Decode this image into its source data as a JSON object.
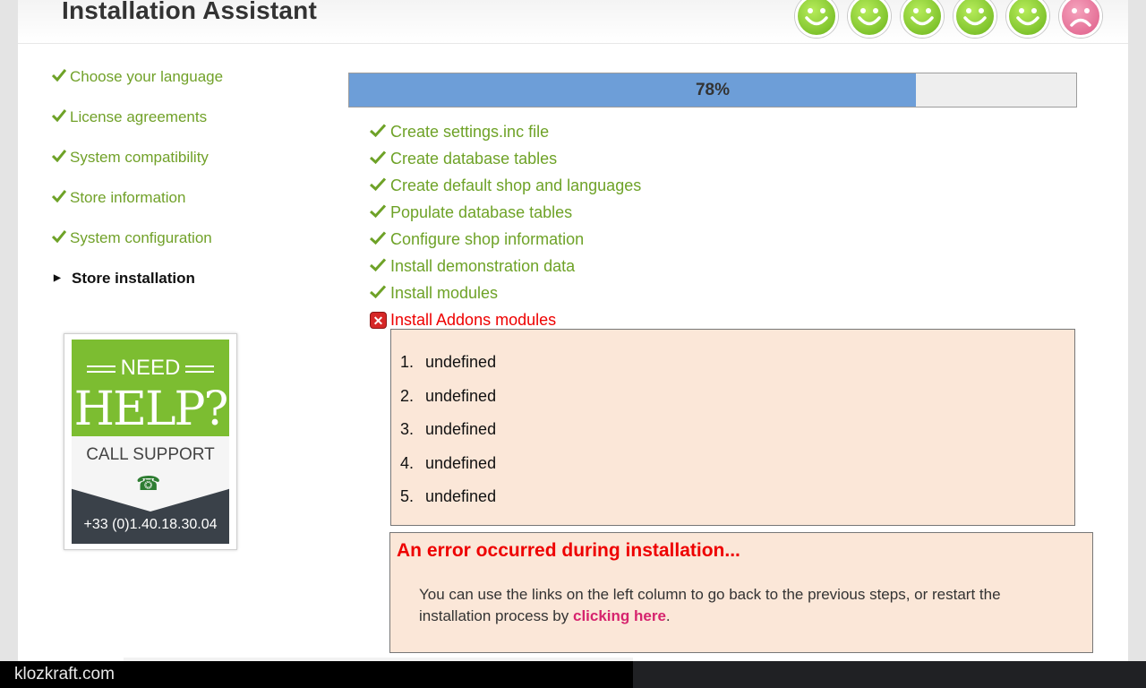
{
  "header": {
    "title": "Installation Assistant"
  },
  "smileys": [
    {
      "mood": "happy",
      "icon": "smiley-happy-icon",
      "color": "#79c22a"
    },
    {
      "mood": "happy",
      "icon": "smiley-happy-icon",
      "color": "#79c22a"
    },
    {
      "mood": "happy",
      "icon": "smiley-happy-icon",
      "color": "#79c22a"
    },
    {
      "mood": "happy",
      "icon": "smiley-happy-icon",
      "color": "#79c22a"
    },
    {
      "mood": "happy",
      "icon": "smiley-happy-icon",
      "color": "#79c22a"
    },
    {
      "mood": "sad",
      "icon": "smiley-sad-icon",
      "color": "#e06690"
    }
  ],
  "sidebar": {
    "items": [
      {
        "label": "Choose your language",
        "state": "done"
      },
      {
        "label": "License agreements",
        "state": "done"
      },
      {
        "label": "System compatibility",
        "state": "done"
      },
      {
        "label": "Store information",
        "state": "done"
      },
      {
        "label": "System configuration",
        "state": "done"
      },
      {
        "label": "Store installation",
        "state": "current"
      }
    ]
  },
  "help_banner": {
    "need": "NEED",
    "help": "HELP?",
    "call": "CALL SUPPORT",
    "phone": "+33 (0)1.40.18.30.04"
  },
  "progress": {
    "value": 0.78,
    "label": "78%"
  },
  "steps": [
    {
      "label": "Create settings.inc file",
      "status": "done"
    },
    {
      "label": "Create database tables",
      "status": "done"
    },
    {
      "label": "Create default shop and languages",
      "status": "done"
    },
    {
      "label": "Populate database tables",
      "status": "done"
    },
    {
      "label": "Configure shop information",
      "status": "done"
    },
    {
      "label": "Install demonstration data",
      "status": "done"
    },
    {
      "label": "Install modules",
      "status": "done"
    },
    {
      "label": "Install Addons modules",
      "status": "error"
    }
  ],
  "errors_list": [
    {
      "num": "1.",
      "text": "undefined"
    },
    {
      "num": "2.",
      "text": "undefined"
    },
    {
      "num": "3.",
      "text": "undefined"
    },
    {
      "num": "4.",
      "text": "undefined"
    },
    {
      "num": "5.",
      "text": "undefined"
    }
  ],
  "error_box": {
    "title": "An error occurred during installation...",
    "text_before": "You can use the links on the left column to go back to the previous steps, or restart the installation process by ",
    "link": "clicking here",
    "text_after": "."
  },
  "status_bar": {
    "text": "klozkraft.com"
  },
  "colors": {
    "green": "#6ea227",
    "error": "#ee0000",
    "progress": "#6d9ed8",
    "link": "#d6246e"
  }
}
